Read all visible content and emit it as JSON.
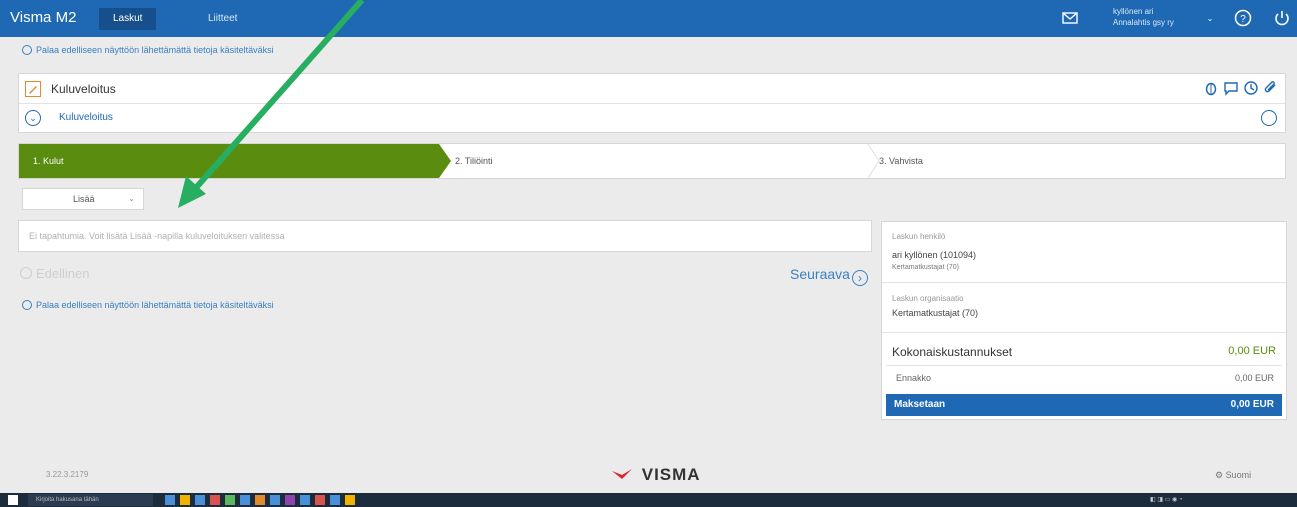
{
  "topbar": {
    "brand": "Visma M2",
    "tabs": [
      {
        "label": "Laskut",
        "active": true
      },
      {
        "label": "Liitteet",
        "active": false
      }
    ],
    "user_line1": "kyllönen ari",
    "user_line2": "Annalahtis gsy ry",
    "icons": [
      "mail-icon",
      "help-icon",
      "power-icon"
    ]
  },
  "back_link_top": "Palaa edelliseen näyttöön lähettämättä tietoja käsiteltäväksi",
  "panel": {
    "title": "Kuluveloitus",
    "subtitle": "Kuluveloitus",
    "action_icons": [
      "bug-icon",
      "comment-icon",
      "history-icon",
      "attachment-icon"
    ]
  },
  "steps": [
    {
      "label": "1. Kulut",
      "active": true
    },
    {
      "label": "2. Tiliöinti",
      "active": false
    },
    {
      "label": "3. Vahvista",
      "active": false
    }
  ],
  "add_select": {
    "label": "Lisää"
  },
  "search": {
    "placeholder": "Ei tapahtumia. Voit lisätä Lisää -napilla kuluveloituksen valitessa"
  },
  "nav": {
    "previous": "Edellinen",
    "next": "Seuraava"
  },
  "back_link_bottom": "Palaa edelliseen näyttöön lähettämättä tietoja käsiteltäväksi",
  "summary": {
    "person_label": "Laskun henkilö",
    "person_value": "ari kyllönen (101094)",
    "person_sub": "Kertamatkustajat (70)",
    "org_label": "Laskun organisaatio",
    "org_value": "Kertamatkustajat (70)",
    "total_label": "Kokonaiskustannukset",
    "total_value": "0,00 EUR",
    "advance_label": "Ennakko",
    "advance_value": "0,00 EUR",
    "pay_label": "Maksetaan",
    "pay_value": "0,00 EUR"
  },
  "footer": {
    "version": "3.22.3.2179",
    "logo": "VISMA",
    "language": "Suomi"
  },
  "taskbar": {
    "search_placeholder": "Kirjoita hakusana tähän"
  },
  "colors": {
    "topbar": "#1f68b3",
    "step_active": "#5a8c0f",
    "total_value": "#5a8c0f",
    "arrow": "#27ae60"
  }
}
